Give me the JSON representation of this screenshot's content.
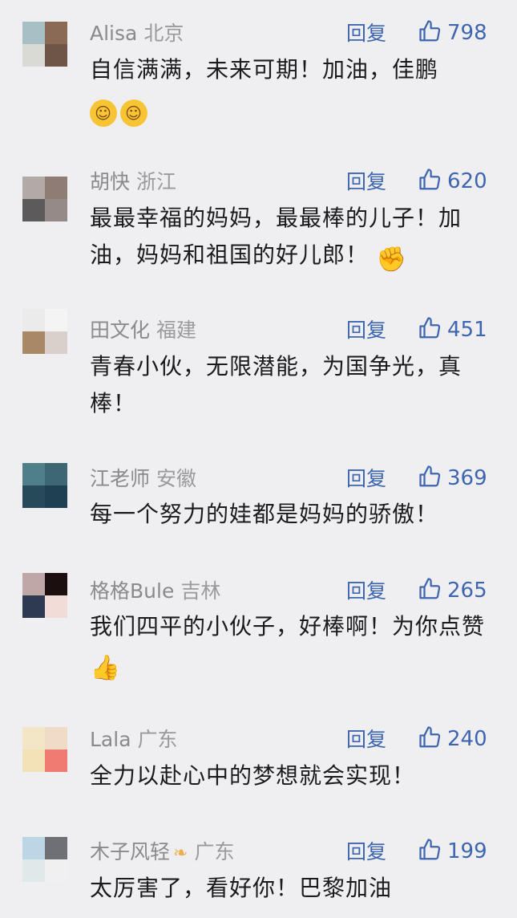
{
  "reply_label": "回复",
  "comments": [
    {
      "username": "Alisa",
      "location": "北京",
      "likes": "798",
      "text": "自信满满，未来可期！加油，佳鹏",
      "emojis": [
        "salute-face",
        "salute-face"
      ],
      "avatar_colors": [
        "#a9bfc6",
        "#8a6a55",
        "#d8dad3",
        "#6f5448"
      ]
    },
    {
      "username": "胡快",
      "location": "浙江",
      "likes": "620",
      "text": "最最幸福的妈妈，最最棒的儿子！加油，妈妈和祖国的好儿郎！",
      "emojis": [
        "fist"
      ],
      "avatar_colors": [
        "#b3a9a6",
        "#8f7d75",
        "#5d5a5b",
        "#958a88"
      ]
    },
    {
      "username": "田文化",
      "location": "福建",
      "likes": "451",
      "text": "青春小伙，无限潜能，为国争光，真棒！",
      "emojis": [],
      "avatar_colors": [
        "#ecebeb",
        "#f4f4f4",
        "#a98866",
        "#d9cfcb"
      ]
    },
    {
      "username": "江老师",
      "location": "安徽",
      "likes": "369",
      "text": "每一个努力的娃都是妈妈的骄傲！",
      "emojis": [],
      "avatar_colors": [
        "#4f7f88",
        "#3d6772",
        "#264a5a",
        "#1f4052"
      ]
    },
    {
      "username": "格格Bule",
      "location": "吉林",
      "likes": "265",
      "text": "我们四平的小伙子，好棒啊！为你点赞",
      "emojis": [
        "thumbs-up"
      ],
      "avatar_colors": [
        "#bfa7a8",
        "#1c0f0f",
        "#2e3a4f",
        "#f1dcd7"
      ]
    },
    {
      "username": "Lala",
      "location": "广东",
      "likes": "240",
      "text": "全力以赴心中的梦想就会实现！",
      "emojis": [],
      "avatar_colors": [
        "#f2e6c6",
        "#f0dcc6",
        "#f3e2b8",
        "#ef7b72"
      ]
    },
    {
      "username": "木子风轻",
      "location": "广东",
      "likes": "199",
      "text": "太厉害了，看好你！巴黎加油",
      "badge": "butterfly-icon",
      "emojis": [],
      "avatar_colors": [
        "#bcd6e6",
        "#6f7076",
        "#dfe9ea",
        "#f0f0f0"
      ]
    }
  ]
}
